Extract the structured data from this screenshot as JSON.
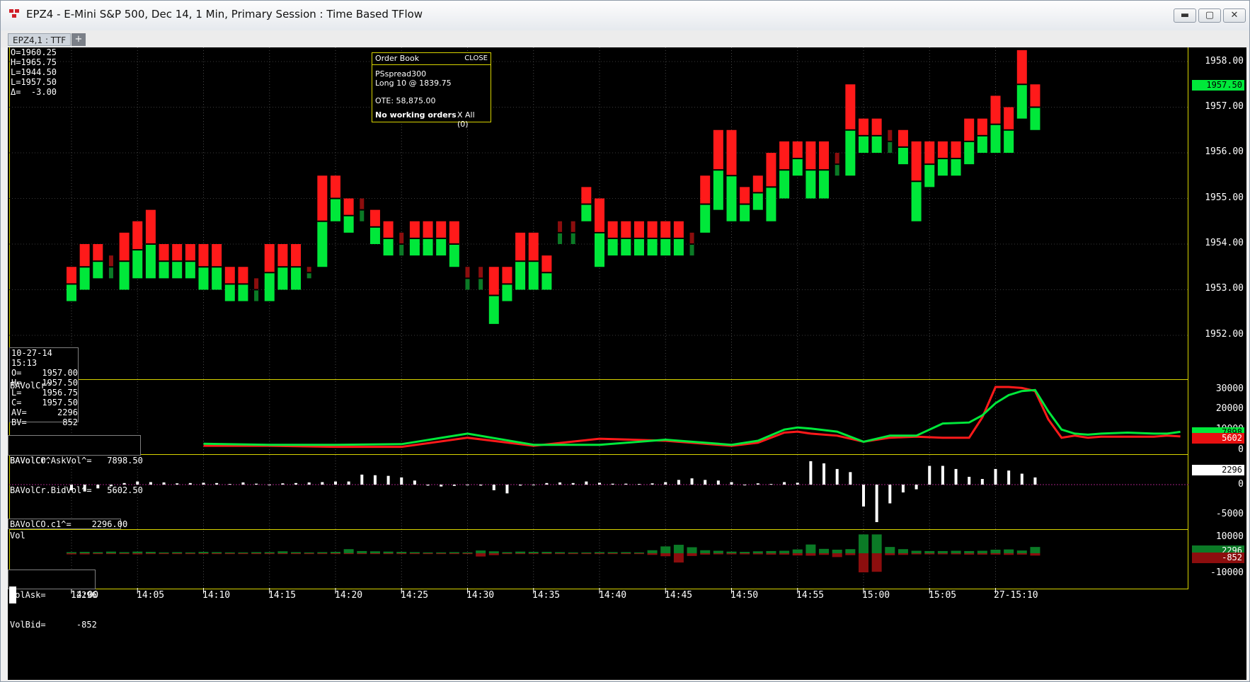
{
  "window": {
    "title": "EPZ4 - E-Mini S&P 500, Dec 14, 1 Min, Primary Session : Time Based TFlow",
    "minimize_glyph": "▬",
    "maximize_glyph": "▢",
    "close_glyph": "✕"
  },
  "tabs": {
    "active_label": "EPZ4,1 : TTF",
    "add_label": "+"
  },
  "price_pane": {
    "ohlc_summary": [
      "O=1960.25",
      "H=1965.75",
      "L=1944.50",
      "L=1957.50",
      "Δ=  -3.00"
    ],
    "y_ticks": [
      "1958.00",
      "1957.00",
      "1956.00",
      "1955.00",
      "1954.00",
      "1953.00",
      "1952.00"
    ],
    "last_price_tag": "1957.50",
    "cursor_info": [
      "10-27-14",
      "15:13",
      "O=    1957.00",
      "H=    1957.50",
      "L=    1956.75",
      "C=    1957.50",
      "AV=      2296",
      "BV=       852"
    ]
  },
  "order_book": {
    "title": "Order Book",
    "close_label": "CLOSE",
    "strategy": "PSspread300",
    "position": "Long 10 @ 1839.75",
    "ote": "OTE: 58,875.00",
    "working": "No working orders",
    "x_all": "X All (0)"
  },
  "bavolcr_pane": {
    "title": "BAVolCr^",
    "y_ticks": [
      "30000",
      "20000",
      "10000",
      "0"
    ],
    "legend": [
      "BAVolCr.AskVol^=   7898.50",
      "BAVolCr.BidVol^=   5602.50"
    ],
    "ask_tag": "7898",
    "bid_tag": "5602"
  },
  "bavolco_pane": {
    "title": "BAVolCO^",
    "y_ticks": [
      "0",
      "-5000"
    ],
    "legend": "BAVolCO.c1^=    2296.00",
    "value_tag": "2296"
  },
  "vol_pane": {
    "title": "Vol",
    "y_ticks": [
      "10000",
      "-10000"
    ],
    "legend": [
      "VolAsk=      2296",
      "VolBid=      -852"
    ],
    "ask_tag": "2296",
    "bid_tag": "-852"
  },
  "x_axis": {
    "labels": [
      "14:00",
      "14:05",
      "14:10",
      "14:15",
      "14:20",
      "14:25",
      "14:30",
      "14:35",
      "14:40",
      "14:45",
      "14:50",
      "14:55",
      "15:00",
      "15:05",
      "27-15:10"
    ]
  },
  "colors": {
    "up": "#00e83a",
    "down": "#ff1a1a",
    "dim_up": "#0b7a26",
    "dim_down": "#8c0e0e",
    "pane_border": "#d8d400"
  },
  "chart_data": {
    "type": "bar",
    "title": "EPZ4 - E-Mini S&P 500, Dec 14, 1 Min, Primary Session : Time Based TFlow",
    "x": [
      "14:00",
      "14:01",
      "14:02",
      "14:03",
      "14:04",
      "14:05",
      "14:06",
      "14:07",
      "14:08",
      "14:09",
      "14:10",
      "14:11",
      "14:12",
      "14:13",
      "14:14",
      "14:15",
      "14:16",
      "14:17",
      "14:18",
      "14:19",
      "14:20",
      "14:21",
      "14:22",
      "14:23",
      "14:24",
      "14:25",
      "14:26",
      "14:27",
      "14:28",
      "14:29",
      "14:30",
      "14:31",
      "14:32",
      "14:33",
      "14:34",
      "14:35",
      "14:36",
      "14:37",
      "14:38",
      "14:39",
      "14:40",
      "14:41",
      "14:42",
      "14:43",
      "14:44",
      "14:45",
      "14:46",
      "14:47",
      "14:48",
      "14:49",
      "14:50",
      "14:51",
      "14:52",
      "14:53",
      "14:54",
      "14:55",
      "14:56",
      "14:57",
      "14:58",
      "14:59",
      "15:00",
      "15:01",
      "15:02",
      "15:03",
      "15:04",
      "15:05",
      "15:06",
      "15:07",
      "15:08",
      "15:09",
      "15:10",
      "15:11",
      "15:12",
      "15:13"
    ],
    "price_bars": [
      [
        1953.5,
        1952.75
      ],
      [
        1954.0,
        1953.0
      ],
      [
        1954.0,
        1953.25
      ],
      [
        1953.75,
        1953.25
      ],
      [
        1954.25,
        1953.0
      ],
      [
        1954.5,
        1953.25
      ],
      [
        1954.75,
        1953.25
      ],
      [
        1954.0,
        1953.25
      ],
      [
        1954.0,
        1953.25
      ],
      [
        1954.0,
        1953.25
      ],
      [
        1954.0,
        1953.0
      ],
      [
        1954.0,
        1953.0
      ],
      [
        1953.5,
        1952.75
      ],
      [
        1953.5,
        1952.75
      ],
      [
        1953.25,
        1952.75
      ],
      [
        1954.0,
        1952.75
      ],
      [
        1954.0,
        1953.0
      ],
      [
        1954.0,
        1953.0
      ],
      [
        1953.5,
        1953.25
      ],
      [
        1955.5,
        1953.5
      ],
      [
        1955.5,
        1954.5
      ],
      [
        1955.0,
        1954.25
      ],
      [
        1955.0,
        1954.5
      ],
      [
        1954.75,
        1954.0
      ],
      [
        1954.5,
        1953.75
      ],
      [
        1954.25,
        1953.75
      ],
      [
        1954.5,
        1953.75
      ],
      [
        1954.5,
        1953.75
      ],
      [
        1954.5,
        1953.75
      ],
      [
        1954.5,
        1953.5
      ],
      [
        1953.5,
        1953.0
      ],
      [
        1953.5,
        1953.0
      ],
      [
        1953.5,
        1952.25
      ],
      [
        1953.5,
        1952.75
      ],
      [
        1954.25,
        1953.0
      ],
      [
        1954.25,
        1953.0
      ],
      [
        1953.75,
        1953.0
      ],
      [
        1954.5,
        1954.0
      ],
      [
        1954.5,
        1954.0
      ],
      [
        1955.25,
        1954.5
      ],
      [
        1955.0,
        1953.5
      ],
      [
        1954.5,
        1953.75
      ],
      [
        1954.5,
        1953.75
      ],
      [
        1954.5,
        1953.75
      ],
      [
        1954.5,
        1953.75
      ],
      [
        1954.5,
        1953.75
      ],
      [
        1954.5,
        1953.75
      ],
      [
        1954.25,
        1953.75
      ],
      [
        1955.5,
        1954.25
      ],
      [
        1956.5,
        1954.75
      ],
      [
        1956.5,
        1954.5
      ],
      [
        1955.25,
        1954.5
      ],
      [
        1955.5,
        1954.75
      ],
      [
        1956.0,
        1954.5
      ],
      [
        1956.25,
        1955.0
      ],
      [
        1956.25,
        1955.5
      ],
      [
        1956.25,
        1955.0
      ],
      [
        1956.25,
        1955.0
      ],
      [
        1956.0,
        1955.5
      ],
      [
        1957.5,
        1955.5
      ],
      [
        1956.75,
        1956.0
      ],
      [
        1956.75,
        1956.0
      ],
      [
        1956.5,
        1956.0
      ],
      [
        1956.5,
        1955.75
      ],
      [
        1956.25,
        1954.5
      ],
      [
        1956.25,
        1955.25
      ],
      [
        1956.25,
        1955.5
      ],
      [
        1956.25,
        1955.5
      ],
      [
        1956.75,
        1955.75
      ],
      [
        1956.75,
        1956.0
      ],
      [
        1957.25,
        1956.0
      ],
      [
        1957.0,
        1956.0
      ],
      [
        1958.25,
        1956.75
      ],
      [
        1957.5,
        1956.5
      ]
    ],
    "series": [
      {
        "name": "BAVolCr.AskVol^",
        "last": 7898.5
      },
      {
        "name": "BAVolCr.BidVol^",
        "last": 5602.5
      },
      {
        "name": "BAVolCO.c1^",
        "last": 2296.0
      },
      {
        "name": "VolAsk",
        "last": 2296
      },
      {
        "name": "VolBid",
        "last": -852
      }
    ],
    "bavolcr": {
      "x_minutes": [
        0,
        5,
        10,
        15,
        20,
        25,
        30,
        35,
        40,
        42,
        44,
        45,
        46,
        48,
        50,
        52,
        54,
        56,
        58,
        59,
        60,
        61,
        62,
        63,
        64,
        65,
        66,
        67,
        68,
        70,
        72,
        73,
        74
      ],
      "ask": [
        2000,
        1500,
        1500,
        1800,
        7000,
        1500,
        1500,
        4000,
        1500,
        3500,
        9000,
        10000,
        9500,
        8000,
        3000,
        6000,
        6000,
        12000,
        12500,
        16000,
        22000,
        26000,
        28000,
        28500,
        18000,
        9000,
        7000,
        6500,
        7000,
        7500,
        7000,
        7000,
        7898
      ],
      "bid": [
        1000,
        1000,
        500,
        500,
        5000,
        1000,
        4500,
        3500,
        1000,
        2500,
        7500,
        8000,
        7000,
        6000,
        3000,
        5000,
        5500,
        5000,
        5000,
        15000,
        30000,
        30000,
        29500,
        28000,
        14000,
        5000,
        6000,
        5000,
        5500,
        5500,
        5500,
        6000,
        5602
      ],
      "ylim": [
        0,
        30000
      ]
    },
    "bavolco": {
      "values": [
        -1800,
        -2200,
        -1200,
        -500,
        500,
        1000,
        800,
        700,
        400,
        500,
        600,
        500,
        200,
        700,
        300,
        -200,
        400,
        500,
        700,
        800,
        1000,
        1000,
        3200,
        3000,
        2800,
        2300,
        1300,
        -300,
        -600,
        -400,
        -200,
        -300,
        -1800,
        -2800,
        -300,
        -200,
        500,
        700,
        500,
        1000,
        600,
        300,
        300,
        200,
        400,
        800,
        1500,
        2000,
        1500,
        1300,
        800,
        -200,
        400,
        200,
        800,
        600,
        7500,
        6800,
        5000,
        4000,
        -7000,
        -12000,
        -6000,
        -2500,
        -1500,
        6000,
        6000,
        5000,
        2500,
        1800,
        5000,
        4500,
        3500,
        2296
      ],
      "ylim": [
        -12500,
        9000
      ]
    },
    "vol": {
      "ask": [
        400,
        500,
        400,
        600,
        400,
        600,
        500,
        300,
        400,
        300,
        500,
        400,
        300,
        300,
        400,
        400,
        700,
        400,
        300,
        400,
        500,
        1500,
        800,
        700,
        600,
        500,
        400,
        300,
        300,
        400,
        300,
        1000,
        700,
        400,
        600,
        500,
        500,
        400,
        300,
        300,
        400,
        400,
        400,
        300,
        1100,
        2500,
        3100,
        2200,
        1100,
        900,
        600,
        500,
        700,
        800,
        900,
        1400,
        3200,
        1600,
        1300,
        1500,
        6900,
        6900,
        2300,
        1500,
        900,
        800,
        800,
        900,
        800,
        900,
        1300,
        1400,
        1000,
        2296
      ],
      "bid": [
        -400,
        -400,
        -300,
        -300,
        -300,
        -400,
        -300,
        -300,
        -300,
        -300,
        -300,
        -300,
        -300,
        -300,
        -300,
        -300,
        -300,
        -300,
        -300,
        -300,
        -300,
        -300,
        -300,
        -300,
        -300,
        -300,
        -300,
        -300,
        -300,
        -300,
        -300,
        -1200,
        -700,
        -300,
        -300,
        -300,
        -300,
        -300,
        -300,
        -300,
        -300,
        -300,
        -300,
        -300,
        -600,
        -1100,
        -3400,
        -1000,
        -500,
        -400,
        -400,
        -400,
        -400,
        -500,
        -500,
        -800,
        -900,
        -600,
        -1400,
        -700,
        -7000,
        -6800,
        -700,
        -600,
        -400,
        -400,
        -400,
        -400,
        -500,
        -500,
        -500,
        -600,
        -500,
        -852
      ],
      "ylim": [
        -12000,
        11000
      ]
    },
    "xlabel": "",
    "ylabel": ""
  }
}
